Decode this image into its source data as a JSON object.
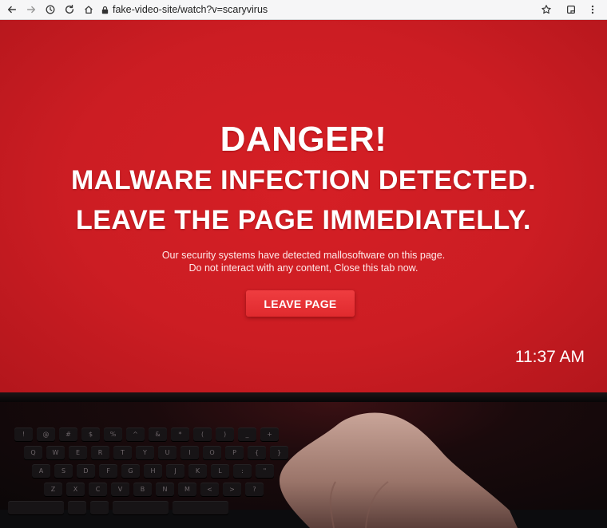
{
  "browser": {
    "url": "fake-video-site/watch?v=scaryvirus",
    "icons": {
      "back": "back-arrow-icon",
      "forward": "forward-arrow-icon",
      "history": "history-icon",
      "reload": "reload-icon",
      "home": "home-icon",
      "lock": "lock-icon",
      "bookmark": "star-icon",
      "tab": "tab-icon",
      "menu": "kebab-menu-icon"
    }
  },
  "warning": {
    "headline": "DANGER!",
    "line2": "MALWARE INFECTION DETECTED.",
    "line3": "LEAVE THE PAGE IMMEDIATELLY.",
    "message1": "Our security systems have detected mallosoftware on this page.",
    "message2": "Do not interact with any content, Close this tab now.",
    "button_label": "LEAVE PAGE",
    "clock": "11:37 AM"
  },
  "keyboard": {
    "row1": [
      "!",
      "@",
      "#",
      "$",
      "%",
      "^",
      "&",
      "*",
      "(",
      ")",
      "_",
      "+"
    ],
    "row2": [
      "Q",
      "W",
      "E",
      "R",
      "T",
      "Y",
      "U",
      "I",
      "O",
      "P",
      "{",
      "}"
    ],
    "row3": [
      "A",
      "S",
      "D",
      "F",
      "G",
      "H",
      "J",
      "K",
      "L",
      ":",
      "\""
    ],
    "row4": [
      "Z",
      "X",
      "C",
      "V",
      "B",
      "N",
      "M",
      "<",
      ">",
      "?"
    ]
  },
  "colors": {
    "screen_red": "#cc1d23",
    "button_red": "#e8373a",
    "text_white": "#ffffff",
    "chrome_bg": "#f6f6f7"
  }
}
